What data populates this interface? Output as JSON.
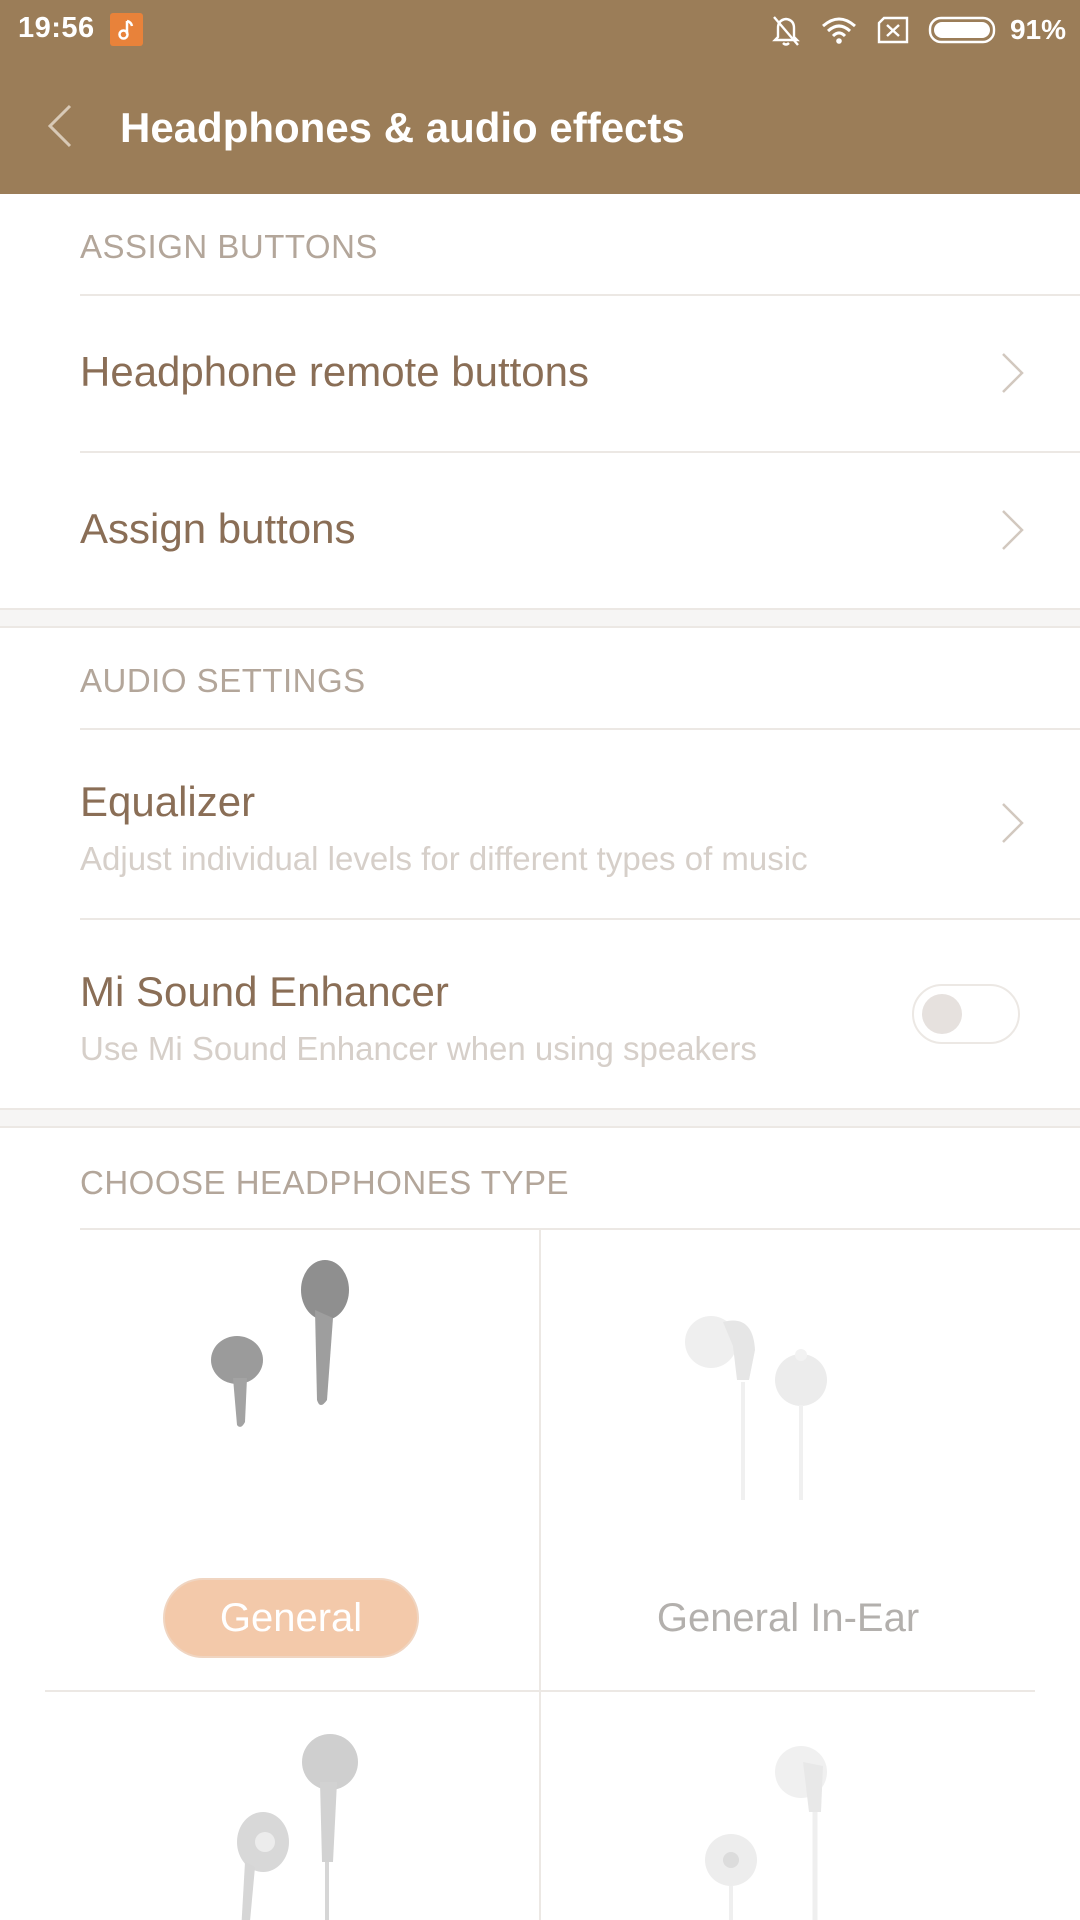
{
  "status_bar": {
    "time": "19:56",
    "battery_percent": "91%",
    "icons": [
      "music-app-icon",
      "bell-muted-icon",
      "wifi-icon",
      "no-sim-icon",
      "battery-icon"
    ]
  },
  "app_bar": {
    "title": "Headphones & audio effects",
    "back_icon": "chevron-left-icon"
  },
  "sections": {
    "assign_buttons": {
      "header": "ASSIGN BUTTONS",
      "items": [
        {
          "label": "Headphone remote buttons"
        },
        {
          "label": "Assign buttons"
        }
      ]
    },
    "audio_settings": {
      "header": "AUDIO SETTINGS",
      "equalizer": {
        "label": "Equalizer",
        "subtitle": "Adjust individual levels for different types of music"
      },
      "mi_sound_enhancer": {
        "label": "Mi Sound Enhancer",
        "subtitle": "Use Mi Sound Enhancer when using speakers",
        "enabled": false
      }
    },
    "headphones_type": {
      "header": "CHOOSE HEADPHONES TYPE",
      "options": [
        {
          "label": "General",
          "selected": true
        },
        {
          "label": "General In-Ear",
          "selected": false
        }
      ]
    }
  },
  "colors": {
    "accent_bar": "#9b7d58",
    "title_text": "#8a6e56",
    "header_text": "#b3a69a",
    "selected_pill": "#f3c9aa"
  }
}
